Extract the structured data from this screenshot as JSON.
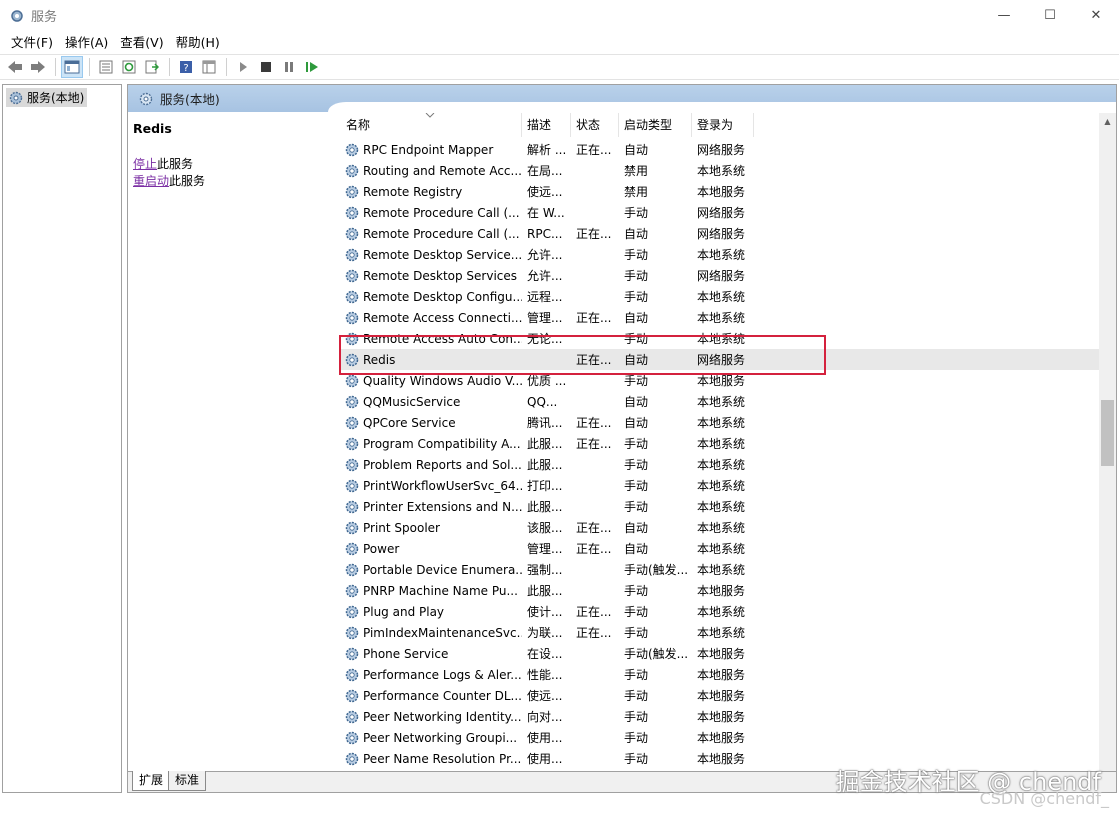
{
  "window": {
    "title": "服务",
    "minimize": "—",
    "maximize": "☐",
    "close": "✕"
  },
  "menu": [
    "文件(F)",
    "操作(A)",
    "查看(V)",
    "帮助(H)"
  ],
  "tree": {
    "root_label": "服务(本地)"
  },
  "panel": {
    "header": "服务(本地)",
    "selected_service": "Redis",
    "action_stop_link": "停止",
    "action_stop_suffix": "此服务",
    "action_restart_link": "重启动",
    "action_restart_suffix": "此服务"
  },
  "columns": {
    "name": "名称",
    "desc": "描述",
    "status": "状态",
    "startup": "启动类型",
    "logon": "登录为"
  },
  "services": [
    {
      "name": "RPC Endpoint Mapper",
      "desc": "解析 ...",
      "status": "正在...",
      "startup": "自动",
      "logon": "网络服务"
    },
    {
      "name": "Routing and Remote Acc...",
      "desc": "在局...",
      "status": "",
      "startup": "禁用",
      "logon": "本地系统"
    },
    {
      "name": "Remote Registry",
      "desc": "使远...",
      "status": "",
      "startup": "禁用",
      "logon": "本地服务"
    },
    {
      "name": "Remote Procedure Call (...",
      "desc": "在 W...",
      "status": "",
      "startup": "手动",
      "logon": "网络服务"
    },
    {
      "name": "Remote Procedure Call (...",
      "desc": "RPC...",
      "status": "正在...",
      "startup": "自动",
      "logon": "网络服务"
    },
    {
      "name": "Remote Desktop Service...",
      "desc": "允许...",
      "status": "",
      "startup": "手动",
      "logon": "本地系统"
    },
    {
      "name": "Remote Desktop Services",
      "desc": "允许...",
      "status": "",
      "startup": "手动",
      "logon": "网络服务"
    },
    {
      "name": "Remote Desktop Configu...",
      "desc": "远程...",
      "status": "",
      "startup": "手动",
      "logon": "本地系统"
    },
    {
      "name": "Remote Access Connecti...",
      "desc": "管理...",
      "status": "正在...",
      "startup": "自动",
      "logon": "本地系统"
    },
    {
      "name": "Remote Access Auto Con...",
      "desc": "无论...",
      "status": "",
      "startup": "手动",
      "logon": "本地系统"
    },
    {
      "name": "Redis",
      "desc": "",
      "status": "正在...",
      "startup": "自动",
      "logon": "网络服务"
    },
    {
      "name": "Quality Windows Audio V...",
      "desc": "优质 ...",
      "status": "",
      "startup": "手动",
      "logon": "本地服务"
    },
    {
      "name": "QQMusicService",
      "desc": "QQ...",
      "status": "",
      "startup": "自动",
      "logon": "本地系统"
    },
    {
      "name": "QPCore Service",
      "desc": "腾讯...",
      "status": "正在...",
      "startup": "自动",
      "logon": "本地系统"
    },
    {
      "name": "Program Compatibility A...",
      "desc": "此服...",
      "status": "正在...",
      "startup": "手动",
      "logon": "本地系统"
    },
    {
      "name": "Problem Reports and Sol...",
      "desc": "此服...",
      "status": "",
      "startup": "手动",
      "logon": "本地系统"
    },
    {
      "name": "PrintWorkflowUserSvc_64...",
      "desc": "打印...",
      "status": "",
      "startup": "手动",
      "logon": "本地系统"
    },
    {
      "name": "Printer Extensions and N...",
      "desc": "此服...",
      "status": "",
      "startup": "手动",
      "logon": "本地系统"
    },
    {
      "name": "Print Spooler",
      "desc": "该服...",
      "status": "正在...",
      "startup": "自动",
      "logon": "本地系统"
    },
    {
      "name": "Power",
      "desc": "管理...",
      "status": "正在...",
      "startup": "自动",
      "logon": "本地系统"
    },
    {
      "name": "Portable Device Enumera...",
      "desc": "强制...",
      "status": "",
      "startup": "手动(触发...",
      "logon": "本地系统"
    },
    {
      "name": "PNRP Machine Name Pu...",
      "desc": "此服...",
      "status": "",
      "startup": "手动",
      "logon": "本地服务"
    },
    {
      "name": "Plug and Play",
      "desc": "使计...",
      "status": "正在...",
      "startup": "手动",
      "logon": "本地系统"
    },
    {
      "name": "PimIndexMaintenanceSvc...",
      "desc": "为联...",
      "status": "正在...",
      "startup": "手动",
      "logon": "本地系统"
    },
    {
      "name": "Phone Service",
      "desc": "在设...",
      "status": "",
      "startup": "手动(触发...",
      "logon": "本地服务"
    },
    {
      "name": "Performance Logs & Aler...",
      "desc": "性能...",
      "status": "",
      "startup": "手动",
      "logon": "本地服务"
    },
    {
      "name": "Performance Counter DL...",
      "desc": "使远...",
      "status": "",
      "startup": "手动",
      "logon": "本地服务"
    },
    {
      "name": "Peer Networking Identity...",
      "desc": "向对...",
      "status": "",
      "startup": "手动",
      "logon": "本地服务"
    },
    {
      "name": "Peer Networking Groupi...",
      "desc": "使用...",
      "status": "",
      "startup": "手动",
      "logon": "本地服务"
    },
    {
      "name": "Peer Name Resolution Pr...",
      "desc": "使用...",
      "status": "",
      "startup": "手动",
      "logon": "本地服务"
    }
  ],
  "highlighted_service": "Redis",
  "tabs": [
    "扩展",
    "标准"
  ],
  "watermark": {
    "main": "掘金技术社区 @ chendf",
    "sub": "CSDN @chendf_"
  },
  "colors": {
    "header_blue": "#b9d1ea",
    "highlight_red": "#d4213d",
    "link_purple": "#7b2fa4"
  }
}
